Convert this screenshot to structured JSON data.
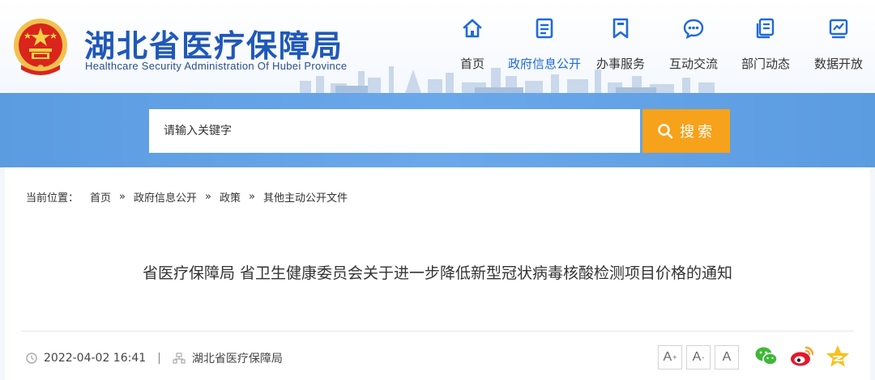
{
  "header": {
    "title_cn": "湖北省医疗保障局",
    "title_en": "Healthcare Security Administration Of Hubei Province"
  },
  "nav": {
    "items": [
      {
        "label": "首页",
        "icon": "home-icon"
      },
      {
        "label": "政府信息公开",
        "icon": "document-icon",
        "active": true
      },
      {
        "label": "办事服务",
        "icon": "bookmark-icon"
      },
      {
        "label": "互动交流",
        "icon": "chat-bubble-icon"
      },
      {
        "label": "部门动态",
        "icon": "news-icon"
      },
      {
        "label": "数据开放",
        "icon": "chart-icon"
      }
    ]
  },
  "search": {
    "placeholder": "请输入关键字",
    "button_label": "搜索"
  },
  "breadcrumb": {
    "prefix": "当前位置：",
    "items": [
      "首页",
      "政府信息公开",
      "政策",
      "其他主动公开文件"
    ]
  },
  "article": {
    "title": "省医疗保障局 省卫生健康委员会关于进一步降低新型冠状病毒核酸检测项目价格的通知",
    "date": "2022-04-02 16:41",
    "separator": "|",
    "source": "湖北省医疗保障局"
  },
  "font_size": {
    "increase": "A",
    "increase_mark": "+",
    "reset": "A",
    "reset_mark": "-",
    "decrease": "A"
  },
  "share": [
    "wechat-icon",
    "weibo-icon",
    "qzone-icon"
  ],
  "colors": {
    "brand_blue": "#1f58b8",
    "nav_active": "#1f6ad8",
    "search_band": "#5b9be0",
    "search_button": "#f6a21b"
  }
}
